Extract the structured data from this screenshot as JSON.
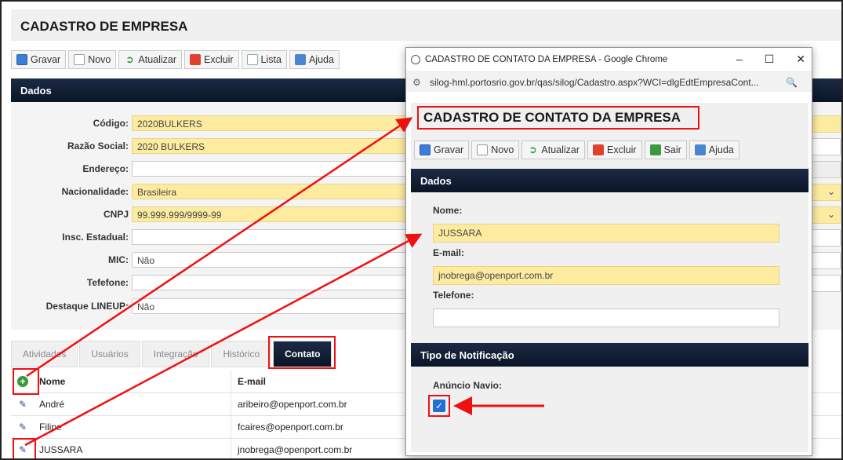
{
  "main": {
    "title": "CADASTRO DE EMPRESA",
    "toolbar": [
      "Gravar",
      "Novo",
      "Atualizar",
      "Excluir",
      "Lista",
      "Ajuda"
    ],
    "section": "Dados",
    "fields": [
      {
        "label": "Código:",
        "value": "2020BULKERS",
        "style": "yellow"
      },
      {
        "label": "Razão Social:",
        "value": "2020 BULKERS",
        "style": "yellow"
      },
      {
        "label": "Endereço:",
        "value": "",
        "style": "plain"
      },
      {
        "label": "Nacionalidade:",
        "value": "Brasileira",
        "style": "yellow-select"
      },
      {
        "label": "CNPJ",
        "value": "99.999.999/9999-99",
        "style": "yellow"
      },
      {
        "label": "Insc. Estadual:",
        "value": "",
        "style": "plain"
      },
      {
        "label": "MIC:",
        "value": "Não",
        "style": "select"
      },
      {
        "label": "Tefefone:",
        "value": "",
        "style": "plain"
      },
      {
        "label": "Destaque LINEUP:",
        "value": "Não",
        "style": "select"
      }
    ],
    "tabs": [
      "Atividades",
      "Usuários",
      "Integração",
      "Histórico",
      "Contato"
    ],
    "grid": {
      "headers": [
        "Nome",
        "E-mail"
      ],
      "rows": [
        {
          "name": "André",
          "email": "aribeiro@openport.com.br"
        },
        {
          "name": "Filipe",
          "email": "fcaires@openport.com.br"
        },
        {
          "name": "JUSSARA",
          "email": "jnobrega@openport.com.br"
        }
      ]
    }
  },
  "popup": {
    "window_title": "CADASTRO DE CONTATO DA EMPRESA - Google Chrome",
    "url": "silog-hml.portosrio.gov.br/qas/silog/Cadastro.aspx?WCI=dlgEdtEmpresaCont...",
    "title": "CADASTRO DE CONTATO DA EMPRESA",
    "toolbar": [
      "Gravar",
      "Novo",
      "Atualizar",
      "Excluir",
      "Sair",
      "Ajuda"
    ],
    "section": "Dados",
    "nome_label": "Nome:",
    "nome_value": "JUSSARA",
    "email_label": "E-mail:",
    "email_value": "jnobrega@openport.com.br",
    "telefone_label": "Telefone:",
    "telefone_value": "",
    "notif_section": "Tipo de Notificação",
    "anuncio_label": "Anúncio Navio:",
    "anuncio_checked": true
  },
  "colors": {
    "accent_red": "#e11",
    "header_dark": "#0b1527",
    "field_yellow": "#fdeca0"
  }
}
